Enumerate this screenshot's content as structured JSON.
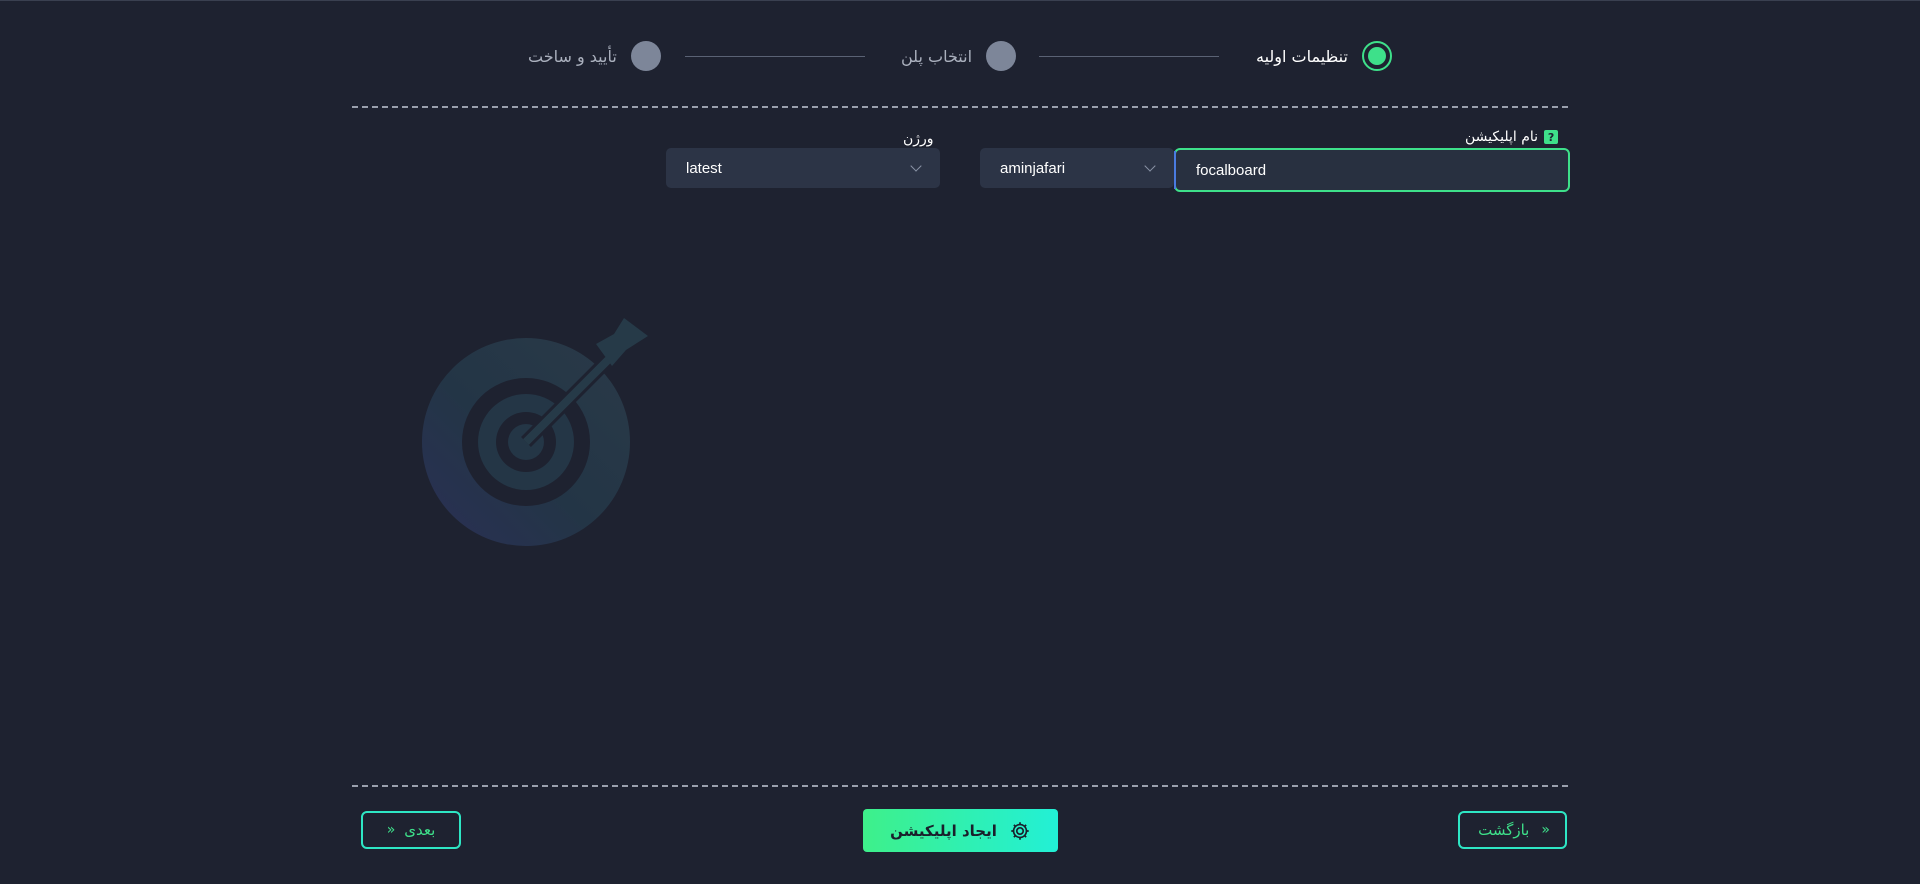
{
  "stepper": {
    "steps": [
      {
        "label": "تنظیمات اولیه",
        "state": "active"
      },
      {
        "label": "انتخاب پلن",
        "state": "pending"
      },
      {
        "label": "تأیید و ساخت",
        "state": "pending"
      }
    ]
  },
  "form": {
    "app_name": {
      "label": "نام اپلیکیشن",
      "help": "?",
      "value": "focalboard"
    },
    "image_select": {
      "value": "aminjafari"
    },
    "version": {
      "label": "ورژن",
      "value": "latest"
    }
  },
  "footer": {
    "back_label": "بازگشت",
    "create_label": "ایجاد اپلیکیشن",
    "next_label": "بعدی"
  },
  "colors": {
    "background": "#1e2230",
    "accent": "#3ee08a",
    "accent_alt": "#22f0d6",
    "inactive_step": "#7d8699"
  }
}
